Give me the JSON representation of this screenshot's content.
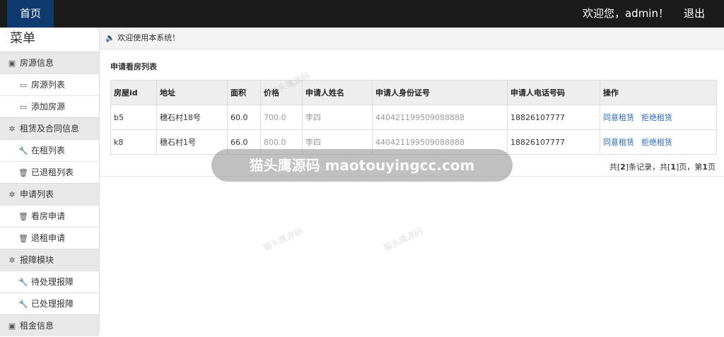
{
  "topbar": {
    "home": "首页",
    "welcome": "欢迎您，admin！",
    "logout": "退出"
  },
  "sidebar": {
    "title": "菜单",
    "groups": [
      {
        "label": "房源信息",
        "icon": "document-icon",
        "items": [
          "房源列表",
          "添加房源"
        ]
      },
      {
        "label": "租赁及合同信息",
        "icon": "gear-icon",
        "items": [
          "在租列表",
          "已退租列表"
        ]
      },
      {
        "label": "申请列表",
        "icon": "gear-icon",
        "items": [
          "看房申请",
          "退租申请"
        ]
      },
      {
        "label": "报障模块",
        "icon": "gear-icon",
        "items": [
          "待处理报障",
          "已处理报障"
        ]
      },
      {
        "label": "租金信息",
        "icon": "document-icon",
        "items": []
      }
    ]
  },
  "main": {
    "notice": "欢迎使用本系统！",
    "panel_title": "申请看房列表",
    "columns": [
      "房屋id",
      "地址",
      "面积",
      "价格",
      "申请人姓名",
      "申请人身份证号",
      "申请人电话号码",
      "操作"
    ],
    "rows": [
      {
        "id": "b5",
        "address": "穗石村18号",
        "area": "60.0",
        "price": "700.0",
        "name": "李四",
        "idcard": "440421199509088888",
        "phone": "18826107777"
      },
      {
        "id": "k8",
        "address": "穗石村1号",
        "area": "66.0",
        "price": "800.0",
        "name": "李四",
        "idcard": "440421199509088888",
        "phone": "18826107777"
      }
    ],
    "actions": {
      "agree": "同意租赁",
      "reject": "拒绝租赁"
    },
    "pager": {
      "p1": "共[",
      "total": "2",
      "p2": "]条记录，共[",
      "pages": "1",
      "p3": "]页，第",
      "current": "1",
      "p4": "页"
    }
  },
  "watermark": {
    "band": "猫头鹰源码 maotouyingcc.com",
    "small": "猫头鹰源码"
  },
  "colors": {
    "topbar": "#1b1b1b",
    "home_tab": "#0e3a6e",
    "link": "#2a6ab5"
  }
}
